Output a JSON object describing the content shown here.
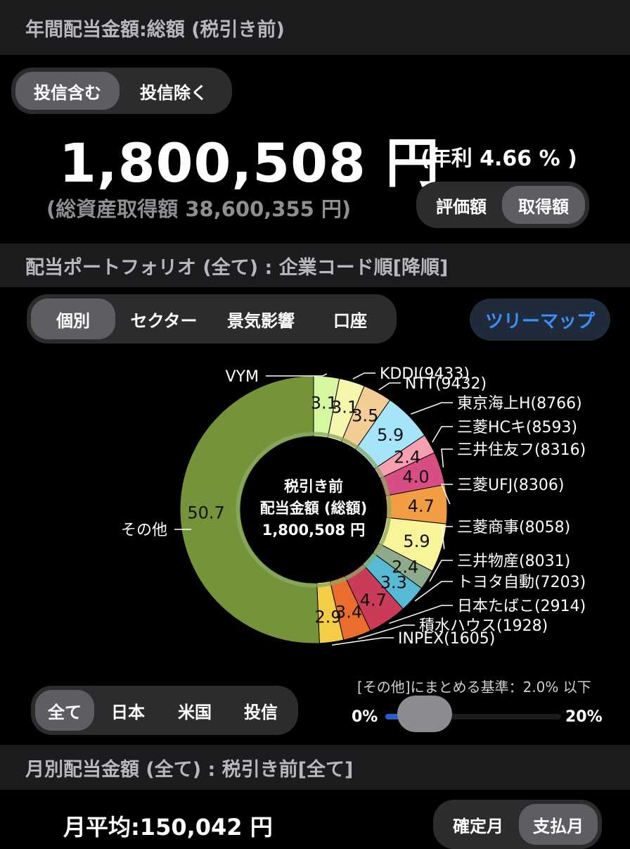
{
  "header": {
    "title": "年間配当金額:総額 (税引き前)"
  },
  "fund_toggle": {
    "options": [
      "投信含む",
      "投信除く"
    ],
    "selected": 0
  },
  "summary": {
    "amount": "1,800,508 円",
    "yield": "(年利 4.66 % )",
    "asset": "(総資産取得額 38,600,355 円)"
  },
  "basis_toggle": {
    "options": [
      "評価額",
      "取得額"
    ],
    "selected": 1
  },
  "portfolio": {
    "title": "配当ポートフォリオ (全て) : 企業コード順[降順]"
  },
  "view_tabs": {
    "options": [
      "個別",
      "セクター",
      "景気影響",
      "口座"
    ],
    "selected": 0
  },
  "treemap_button": "ツリーマップ",
  "colors": {
    "accent_blue": "#3d8ef7",
    "bar_bg": "#1c1c1e",
    "segment_bg": "#2c2c2e"
  },
  "chart_data": {
    "type": "pie",
    "center_text": [
      "税引き前",
      "配当金額 (総額)",
      "1,800,508 円"
    ],
    "slices": [
      {
        "label": "VYM",
        "value": 3.1,
        "color": "#d4f7a0"
      },
      {
        "label": "KDDI(9433)",
        "value": 3.1,
        "color": "#f6f6ad"
      },
      {
        "label": "NTT(9432)",
        "value": 3.5,
        "color": "#f4cc96"
      },
      {
        "label": "東京海上H(8766)",
        "value": 5.9,
        "color": "#a6e4fb"
      },
      {
        "label": "三菱HCキ(8593)",
        "value": 2.4,
        "color": "#f59fb0"
      },
      {
        "label": "三井住友フ(8316)",
        "value": 4.0,
        "color": "#d74d84"
      },
      {
        "label": "三菱UFJ(8306)",
        "value": 4.7,
        "color": "#f39d43"
      },
      {
        "label": "三菱商事(8058)",
        "value": 5.9,
        "color": "#f7f49a"
      },
      {
        "label": "三井物産(8031)",
        "value": 2.4,
        "color": "#8fa98b"
      },
      {
        "label": "トヨタ自動(7203)",
        "value": 3.3,
        "color": "#57bad5"
      },
      {
        "label": "日本たばこ(2914)",
        "value": 4.7,
        "color": "#c93b57"
      },
      {
        "label": "積水ハウス(1928)",
        "value": 3.4,
        "color": "#ea6d2d"
      },
      {
        "label": "INPEX(1605)",
        "value": 2.9,
        "color": "#f2cd45"
      },
      {
        "label": "その他",
        "value": 50.7,
        "color": "#75943a"
      }
    ]
  },
  "region_tabs": {
    "options": [
      "全て",
      "日本",
      "米国",
      "投信"
    ],
    "selected": 0
  },
  "threshold": {
    "label": "[その他]にまとめる基準：2.0% 以下",
    "min": "0%",
    "max": "20%",
    "value_fraction": 0.1
  },
  "monthly": {
    "title": "月別配当金額 (全て) : 税引き前[全て]",
    "average": "月平均:150,042 円",
    "toggle": {
      "options": [
        "確定月",
        "支払月"
      ],
      "selected": 1
    }
  }
}
